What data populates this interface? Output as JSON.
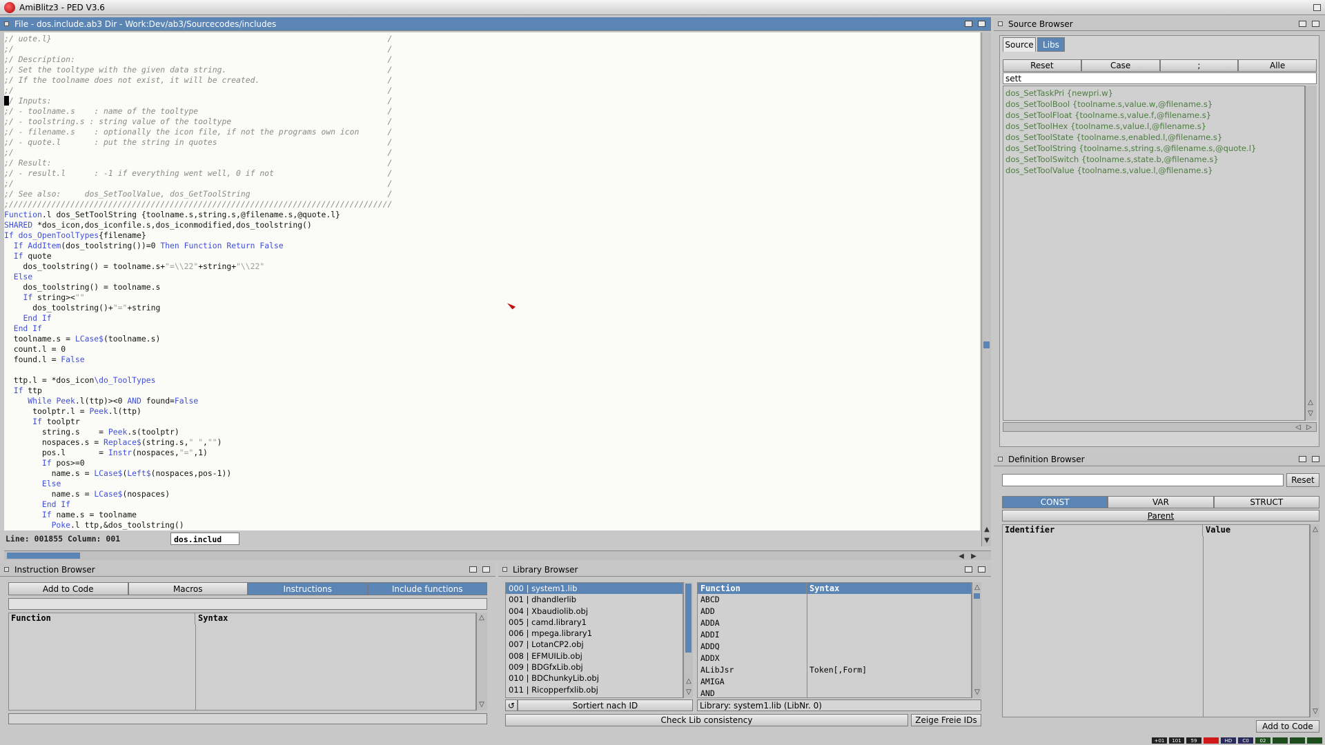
{
  "app": {
    "title": "AmiBlitz3 - PED V3.6"
  },
  "editor": {
    "title": "File - dos.include.ab3  Dir - Work:Dev/ab3/Sourcecodes/includes",
    "status": "Line: 001855 Column: 001",
    "tab_label": "dos.includ",
    "lines": [
      [
        {
          "t": ";/ uote.l}                                                                       /",
          "c": "cm"
        }
      ],
      [
        {
          "t": ";/                                                                               /",
          "c": "cm"
        }
      ],
      [
        {
          "t": ";/ Description:                                                                  /",
          "c": "cm"
        }
      ],
      [
        {
          "t": ";/ Set the tooltype with the given data string.                                  /",
          "c": "cm"
        }
      ],
      [
        {
          "t": ";/ If the toolname does not exist, it will be created.                           /",
          "c": "cm"
        }
      ],
      [
        {
          "t": ";/                                                                               /",
          "c": "cm"
        }
      ],
      [
        {
          "t": ";/ Inputs:                                                                       /",
          "c": "cm"
        }
      ],
      [
        {
          "t": ";/ - toolname.s    : name of the tooltype                                        /",
          "c": "cm"
        }
      ],
      [
        {
          "t": ";/ - toolstring.s : string value of the tooltype                                 /",
          "c": "cm"
        }
      ],
      [
        {
          "t": ";/ - filename.s    : optionally the icon file, if not the programs own icon      /",
          "c": "cm"
        }
      ],
      [
        {
          "t": ";/ - quote.l       : put the string in quotes                                    /",
          "c": "cm"
        }
      ],
      [
        {
          "t": ";/                                                                               /",
          "c": "cm"
        }
      ],
      [
        {
          "t": ";/ Result:                                                                       /",
          "c": "cm"
        }
      ],
      [
        {
          "t": ";/ - result.l      : -1 if everything went well, 0 if not                        /",
          "c": "cm"
        }
      ],
      [
        {
          "t": ";/                                                                               /",
          "c": "cm"
        }
      ],
      [
        {
          "t": ";/ See also:     dos_SetToolValue, dos_GetToolString                             /",
          "c": "cm"
        }
      ],
      [
        {
          "t": ";/////////////////////////////////////////////////////////////////////////////////",
          "c": "cm"
        }
      ],
      [
        {
          "t": "Function",
          "c": "kw"
        },
        {
          "t": ".l dos_SetToolString {toolname.s,string.s,@filename.s,@quote.l}",
          "c": ""
        }
      ],
      [
        {
          "t": "SHARED",
          "c": "kw"
        },
        {
          "t": " *dos_icon,dos_iconfile.s,dos_iconmodified,dos_toolstring()",
          "c": ""
        }
      ],
      [
        {
          "t": "If",
          "c": "kw"
        },
        {
          "t": " dos_OpenToolTypes",
          "c": "fn"
        },
        {
          "t": "{filename}",
          "c": ""
        }
      ],
      [
        {
          "t": "  ",
          "c": ""
        },
        {
          "t": "If",
          "c": "kw"
        },
        {
          "t": " ",
          "c": ""
        },
        {
          "t": "AddItem",
          "c": "fn"
        },
        {
          "t": "(dos_toolstring())=0 ",
          "c": ""
        },
        {
          "t": "Then Function Return False",
          "c": "kw"
        }
      ],
      [
        {
          "t": "  ",
          "c": ""
        },
        {
          "t": "If",
          "c": "kw"
        },
        {
          "t": " quote",
          "c": ""
        }
      ],
      [
        {
          "t": "    dos_toolstring() = toolname.s+",
          "c": ""
        },
        {
          "t": "\"=\\\\22\"",
          "c": "st"
        },
        {
          "t": "+string+",
          "c": ""
        },
        {
          "t": "\"\\\\22\"",
          "c": "st"
        }
      ],
      [
        {
          "t": "  ",
          "c": ""
        },
        {
          "t": "Else",
          "c": "kw"
        }
      ],
      [
        {
          "t": "    dos_toolstring() = toolname.s",
          "c": ""
        }
      ],
      [
        {
          "t": "    ",
          "c": ""
        },
        {
          "t": "If",
          "c": "kw"
        },
        {
          "t": " string><",
          "c": ""
        },
        {
          "t": "\"\"",
          "c": "st"
        }
      ],
      [
        {
          "t": "      dos_toolstring()+",
          "c": ""
        },
        {
          "t": "\"=\"",
          "c": "st"
        },
        {
          "t": "+string",
          "c": ""
        }
      ],
      [
        {
          "t": "    ",
          "c": ""
        },
        {
          "t": "End If",
          "c": "kw"
        }
      ],
      [
        {
          "t": "  ",
          "c": ""
        },
        {
          "t": "End If",
          "c": "kw"
        }
      ],
      [
        {
          "t": "  toolname.s = ",
          "c": ""
        },
        {
          "t": "LCase$",
          "c": "fn"
        },
        {
          "t": "(toolname.s)",
          "c": ""
        }
      ],
      [
        {
          "t": "  count.l = 0",
          "c": ""
        }
      ],
      [
        {
          "t": "  found.l = ",
          "c": ""
        },
        {
          "t": "False",
          "c": "kw"
        }
      ],
      [
        {
          "t": "",
          "c": ""
        }
      ],
      [
        {
          "t": "  ttp.l = *dos_icon",
          "c": ""
        },
        {
          "t": "\\do_ToolTypes",
          "c": "fn"
        }
      ],
      [
        {
          "t": "  ",
          "c": ""
        },
        {
          "t": "If",
          "c": "kw"
        },
        {
          "t": " ttp",
          "c": ""
        }
      ],
      [
        {
          "t": "     ",
          "c": ""
        },
        {
          "t": "While",
          "c": "kw"
        },
        {
          "t": " ",
          "c": ""
        },
        {
          "t": "Peek",
          "c": "fn"
        },
        {
          "t": ".l(ttp)><0 ",
          "c": ""
        },
        {
          "t": "AND",
          "c": "kw"
        },
        {
          "t": " found=",
          "c": ""
        },
        {
          "t": "False",
          "c": "kw"
        }
      ],
      [
        {
          "t": "      toolptr.l = ",
          "c": ""
        },
        {
          "t": "Peek",
          "c": "fn"
        },
        {
          "t": ".l(ttp)",
          "c": ""
        }
      ],
      [
        {
          "t": "      ",
          "c": ""
        },
        {
          "t": "If",
          "c": "kw"
        },
        {
          "t": " toolptr",
          "c": ""
        }
      ],
      [
        {
          "t": "        string.s    = ",
          "c": ""
        },
        {
          "t": "Peek",
          "c": "fn"
        },
        {
          "t": ".s(toolptr)",
          "c": ""
        }
      ],
      [
        {
          "t": "        nospaces.s = ",
          "c": ""
        },
        {
          "t": "Replace$",
          "c": "fn"
        },
        {
          "t": "(string.s,",
          "c": ""
        },
        {
          "t": "\" \"",
          "c": "st"
        },
        {
          "t": ",",
          "c": ""
        },
        {
          "t": "\"\"",
          "c": "st"
        },
        {
          "t": ")",
          "c": ""
        }
      ],
      [
        {
          "t": "        pos.l       = ",
          "c": ""
        },
        {
          "t": "Instr",
          "c": "fn"
        },
        {
          "t": "(nospaces,",
          "c": ""
        },
        {
          "t": "\"=\"",
          "c": "st"
        },
        {
          "t": ",1)",
          "c": ""
        }
      ],
      [
        {
          "t": "        ",
          "c": ""
        },
        {
          "t": "If",
          "c": "kw"
        },
        {
          "t": " pos>=0",
          "c": ""
        }
      ],
      [
        {
          "t": "          name.s = ",
          "c": ""
        },
        {
          "t": "LCase$",
          "c": "fn"
        },
        {
          "t": "(",
          "c": ""
        },
        {
          "t": "Left$",
          "c": "fn"
        },
        {
          "t": "(nospaces,pos-1))",
          "c": ""
        }
      ],
      [
        {
          "t": "        ",
          "c": ""
        },
        {
          "t": "Else",
          "c": "kw"
        }
      ],
      [
        {
          "t": "          name.s = ",
          "c": ""
        },
        {
          "t": "LCase$",
          "c": "fn"
        },
        {
          "t": "(nospaces)",
          "c": ""
        }
      ],
      [
        {
          "t": "        ",
          "c": ""
        },
        {
          "t": "End If",
          "c": "kw"
        }
      ],
      [
        {
          "t": "        ",
          "c": ""
        },
        {
          "t": "If",
          "c": "kw"
        },
        {
          "t": " name.s = toolname",
          "c": ""
        }
      ],
      [
        {
          "t": "          ",
          "c": ""
        },
        {
          "t": "Poke",
          "c": "fn"
        },
        {
          "t": ".l ttp,&dos_toolstring()",
          "c": ""
        }
      ]
    ]
  },
  "source_browser": {
    "title": "Source Browser",
    "tabs": [
      "Source",
      "Libs"
    ],
    "buttons": [
      "Reset",
      "Case",
      ";",
      "Alle"
    ],
    "filter": "sett",
    "items": [
      "dos_SetTaskPri {newpri.w}",
      "dos_SetToolBool {toolname.s,value.w,@filename.s}",
      "dos_SetToolFloat {toolname.s,value.f,@filename.s}",
      "dos_SetToolHex {toolname.s,value.l,@filename.s}",
      "dos_SetToolState {toolname.s,enabled.l,@filename.s}",
      "dos_SetToolString {toolname.s,string.s,@filename.s,@quote.l}",
      "dos_SetToolSwitch {toolname.s,state.b,@filename.s}",
      "dos_SetToolValue {toolname.s,value.l,@filename.s}"
    ]
  },
  "definition_browser": {
    "title": "Definition Browser",
    "reset": "Reset",
    "tabs": [
      "CONST",
      "VAR",
      "STRUCT"
    ],
    "parent": "Parent",
    "col_identifier": "Identifier",
    "col_value": "Value",
    "add_to_code": "Add to Code"
  },
  "instruction_browser": {
    "title": "Instruction Browser",
    "buttons": [
      "Add to Code",
      "Macros",
      "Instructions",
      "Include functions"
    ],
    "col_function": "Function",
    "col_syntax": "Syntax"
  },
  "library_browser": {
    "title": "Library Browser",
    "libs": [
      "000 | system1.lib",
      "001 | dhandlerlib",
      "004 | Xbaudiolib.obj",
      "005 | camd.library1",
      "006 | mpega.library1",
      "007 | LotanCP2.obj",
      "008 | EFMUILib.obj",
      "009 | BDGfxLib.obj",
      "010 | BDChunkyLib.obj",
      "011 | Ricopperfxlib.obj"
    ],
    "col_function": "Function",
    "col_syntax": "Syntax",
    "functions": [
      {
        "f": "ABCD",
        "s": ""
      },
      {
        "f": "ADD",
        "s": ""
      },
      {
        "f": "ADDA",
        "s": ""
      },
      {
        "f": "ADDI",
        "s": ""
      },
      {
        "f": "ADDQ",
        "s": ""
      },
      {
        "f": "ADDX",
        "s": ""
      },
      {
        "f": "ALibJsr",
        "s": "Token[,Form]"
      },
      {
        "f": "AMIGA",
        "s": ""
      },
      {
        "f": "AND",
        "s": ""
      }
    ],
    "sort_label": "Sortiert nach ID",
    "lib_info": "Library: system1.lib (LibNr. 0)",
    "check_button": "Check Lib consistency",
    "free_ids_button": "Zeige Freie IDs"
  },
  "statusbar": {
    "leds": [
      "+01",
      "101",
      "59",
      "",
      "HD",
      "C0",
      "02",
      "",
      "",
      ""
    ],
    "led_colors": [
      "#222",
      "#222",
      "#222",
      "#d01818",
      "#2a2a5a",
      "#2a2a5a",
      "#1d4d1d",
      "#1d4d1d",
      "#1d4d1d",
      "#1d4d1d"
    ]
  },
  "colors": {
    "accent": "#5b85b5",
    "keyword": "#3f4ed8",
    "comment": "#8a8a8a",
    "source_item": "#4b7d3e"
  }
}
